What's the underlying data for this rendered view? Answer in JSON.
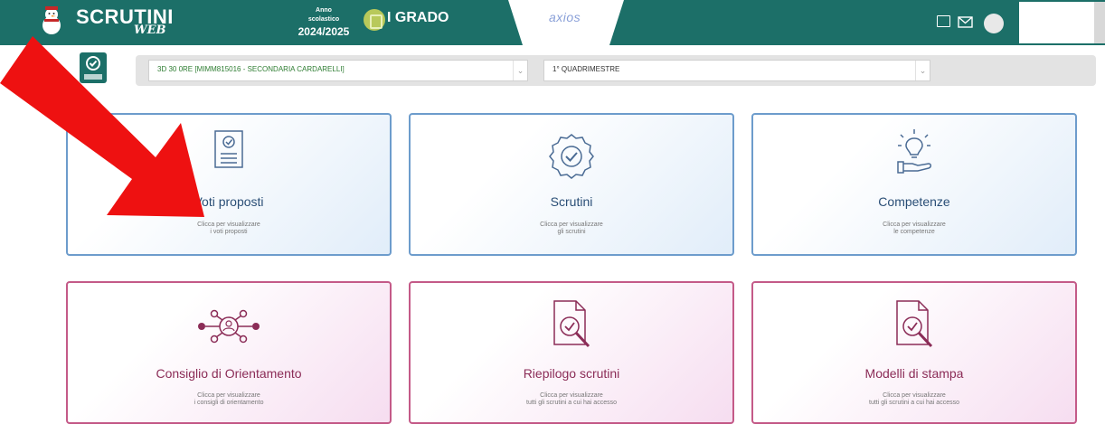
{
  "header": {
    "logo_text": "SCRUTINI",
    "logo_sub": "WEB",
    "year_label_1": "Anno",
    "year_label_2": "scolastico",
    "year_value": "2024/2025",
    "grado": "I GRADO",
    "vendor": "axios"
  },
  "selection": {
    "class_select": "3D 30 0RE [MIMM815016 - SECONDARIA CARDARELLI]",
    "period_select": "1° QUADRIMESTRE"
  },
  "cards": [
    {
      "title": "Voti proposti",
      "desc_1": "Clicca per visualizzare",
      "desc_2": "i voti proposti"
    },
    {
      "title": "Scrutini",
      "desc_1": "Clicca per visualizzare",
      "desc_2": "gli scrutini"
    },
    {
      "title": "Competenze",
      "desc_1": "Clicca per visualizzare",
      "desc_2": "le competenze"
    },
    {
      "title": "Consiglio di Orientamento",
      "desc_1": "Clicca per visualizzare",
      "desc_2": "i consigli di orientamento"
    },
    {
      "title": "Riepilogo scrutini",
      "desc_1": "Clicca per visualizzare",
      "desc_2": "tutti gli scrutini a cui hai accesso"
    },
    {
      "title": "Modelli di stampa",
      "desc_1": "Clicca per visualizzare",
      "desc_2": "tutti gli scrutini a cui hai accesso"
    }
  ],
  "colors": {
    "header_bg": "#1c6f68",
    "card_blue_border": "#6d9ccc",
    "card_pink_border": "#c45a88",
    "select_text": "#2e7d32",
    "arrow": "#ee1111"
  }
}
